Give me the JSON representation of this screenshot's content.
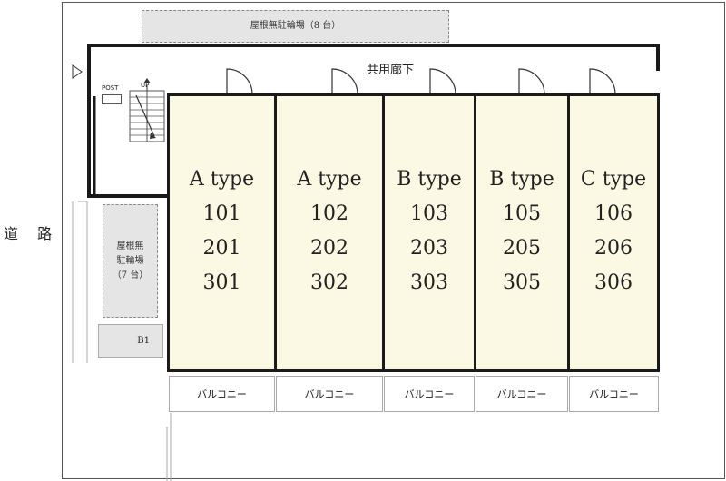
{
  "road": "道 路",
  "corridor": "共用廊下",
  "parking_top": "屋根無駐輪場（8 台）",
  "parking_left": [
    "屋根無",
    "駐輪場",
    "（7 台）"
  ],
  "storage": "B1",
  "post": "POST",
  "stair_up": "UP",
  "units": [
    {
      "type": "A type",
      "rooms": [
        "101",
        "201",
        "301"
      ]
    },
    {
      "type": "A type",
      "rooms": [
        "102",
        "202",
        "302"
      ]
    },
    {
      "type": "B type",
      "rooms": [
        "103",
        "203",
        "303"
      ]
    },
    {
      "type": "B type",
      "rooms": [
        "105",
        "205",
        "305"
      ]
    },
    {
      "type": "C type",
      "rooms": [
        "106",
        "206",
        "306"
      ]
    }
  ],
  "balcony": "バルコニー",
  "colors": {
    "unit_fill": "#fbf9e4",
    "parking_fill": "#e5e5e5",
    "wall": "#1a1a1a"
  }
}
